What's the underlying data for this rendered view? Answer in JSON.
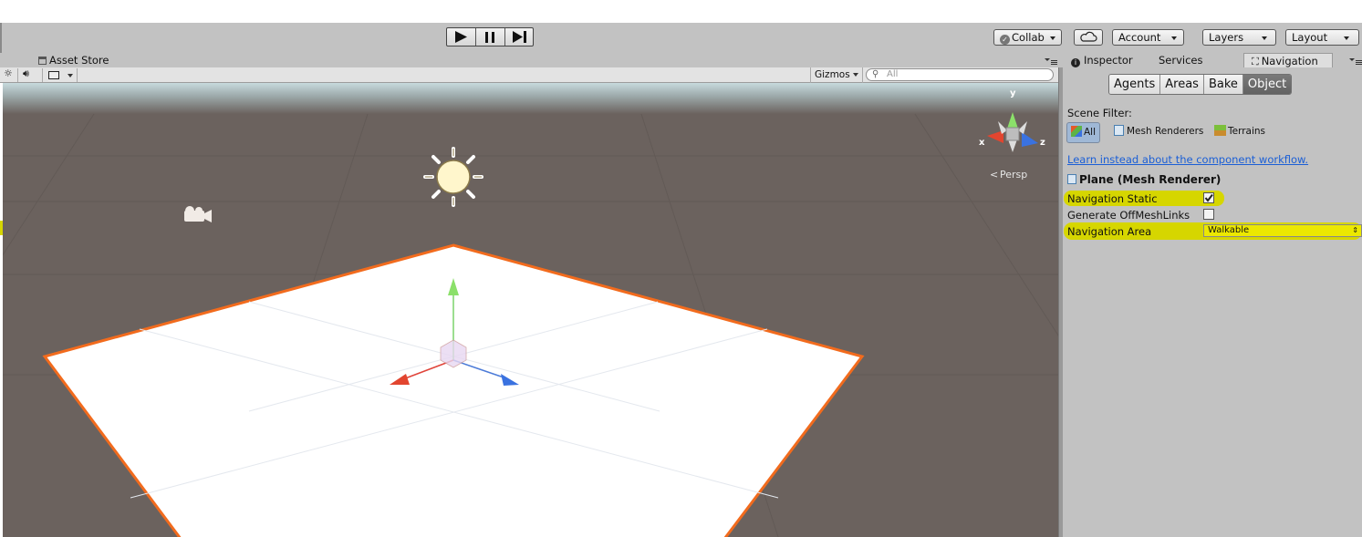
{
  "toolbar": {
    "collab_label": "Collab",
    "account_label": "Account",
    "layers_label": "Layers",
    "layout_label": "Layout",
    "icons": [
      "play-icon",
      "pause-icon",
      "step-icon",
      "check-circle-icon",
      "cloud-icon"
    ]
  },
  "tabs": {
    "asset_store": "Asset Store",
    "inspector": "Inspector",
    "services": "Services",
    "navigation": "Navigation"
  },
  "scene": {
    "gizmos_label": "Gizmos",
    "search_placeholder": "All",
    "axis_y": "y",
    "axis_x": "x",
    "axis_z": "z",
    "projection": "Persp"
  },
  "navigation": {
    "tabs": [
      "Agents",
      "Areas",
      "Bake",
      "Object"
    ],
    "selected_tab": "Object",
    "scene_filter_label": "Scene Filter:",
    "filters": [
      "All",
      "Mesh Renderers",
      "Terrains"
    ],
    "selected_filter": "All",
    "learn_link": "Learn instead about the component workflow.",
    "object_title": "Plane (Mesh Renderer)",
    "nav_static_label": "Navigation Static",
    "nav_static_checked": true,
    "offmesh_label": "Generate OffMeshLinks",
    "offmesh_checked": false,
    "nav_area_label": "Navigation Area",
    "nav_area_value": "Walkable"
  },
  "colors": {
    "highlight": "#d6d600",
    "selection_outline": "#f26b1d",
    "ground": "#6b625e",
    "link": "#1b5fd6"
  }
}
